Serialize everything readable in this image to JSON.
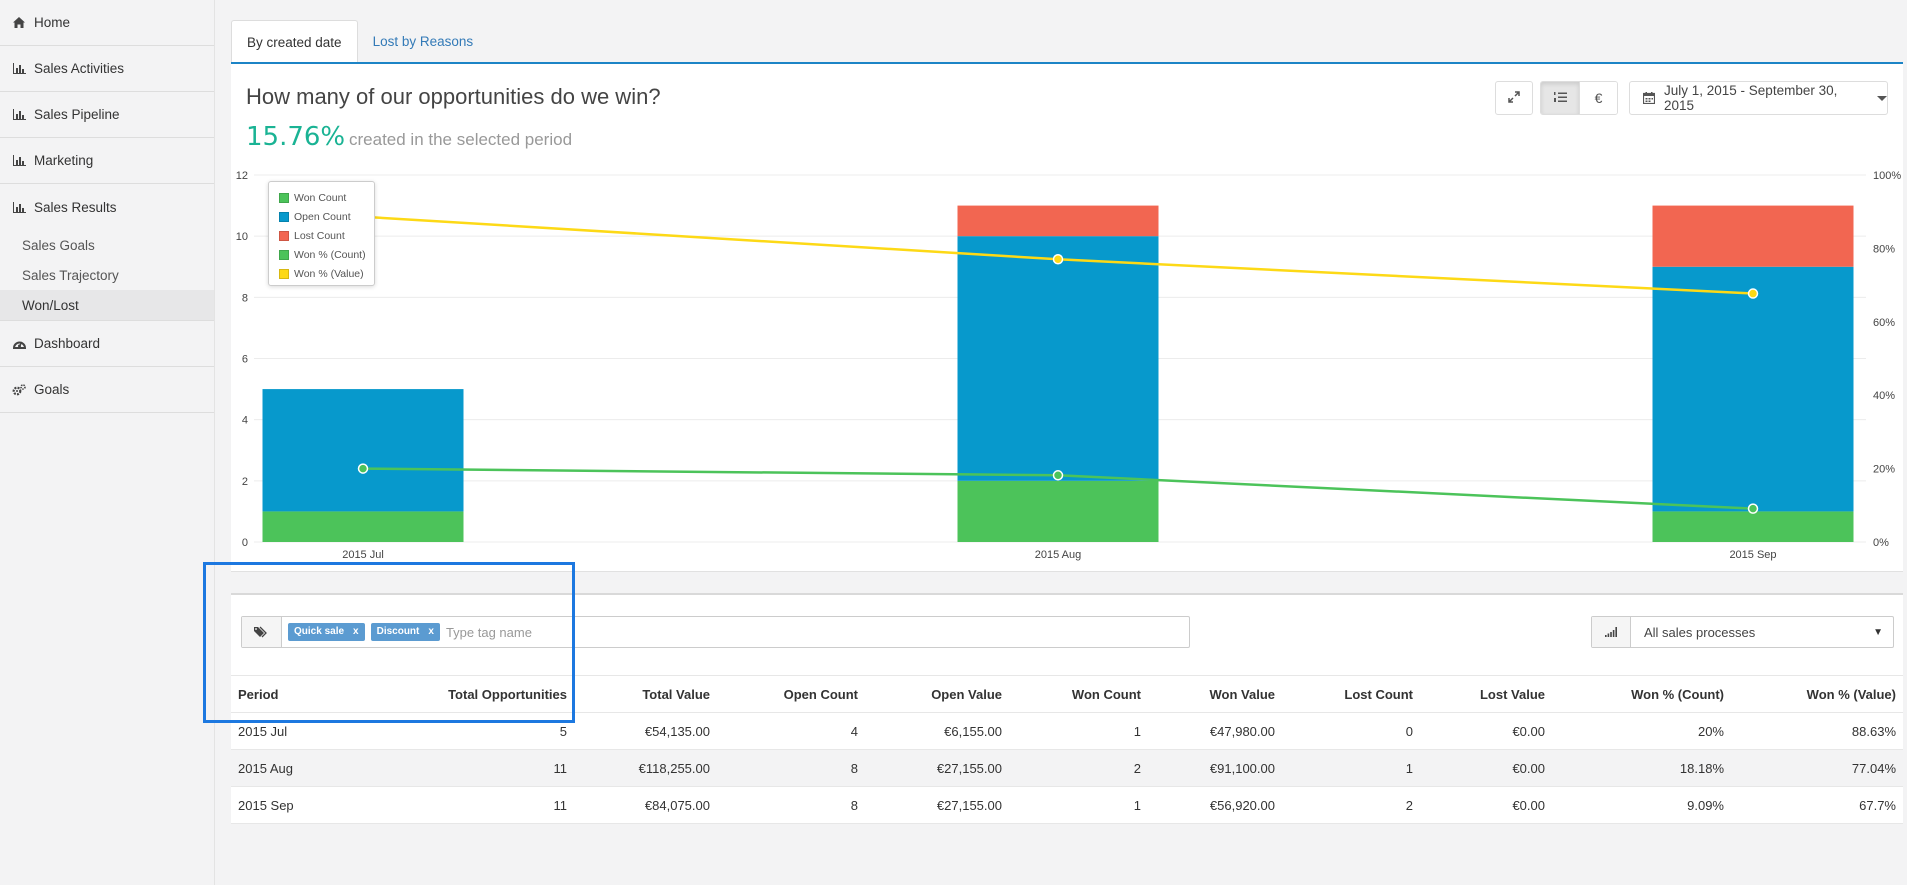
{
  "sidebar": {
    "items": [
      {
        "label": "Home",
        "icon": "home-icon"
      },
      {
        "label": "Sales Activities",
        "icon": "bar-chart-icon"
      },
      {
        "label": "Sales Pipeline",
        "icon": "bar-chart-icon"
      },
      {
        "label": "Marketing",
        "icon": "bar-chart-icon"
      },
      {
        "label": "Sales Results",
        "icon": "bar-chart-icon",
        "children": [
          "Sales Goals",
          "Sales Trajectory",
          "Won/Lost"
        ],
        "active_child": "Won/Lost"
      },
      {
        "label": "Dashboard",
        "icon": "dashboard-icon"
      },
      {
        "label": "Goals",
        "icon": "cogs-icon"
      }
    ]
  },
  "tabs": [
    {
      "label": "By created date",
      "active": true
    },
    {
      "label": "Lost by Reasons",
      "active": false
    }
  ],
  "panel": {
    "title": "How many of our opportunities do we win?",
    "win_rate": "15.76%",
    "win_rate_caption": "created in the selected period",
    "toolbar": {
      "expand_icon": "expand-icon",
      "list_icon": "list-ordered-icon",
      "currency_label": "€",
      "date_range": "July 1, 2015 - September 30, 2015"
    }
  },
  "chart_data": {
    "type": "bar",
    "stacked": true,
    "categories": [
      "2015 Jul",
      "2015 Aug",
      "2015 Sep"
    ],
    "series": [
      {
        "name": "Won Count",
        "type": "bar",
        "axis": "left",
        "color": "#4cc35a",
        "values": [
          1,
          2,
          1
        ]
      },
      {
        "name": "Open Count",
        "type": "bar",
        "axis": "left",
        "color": "#0799cc",
        "values": [
          4,
          8,
          8
        ]
      },
      {
        "name": "Lost Count",
        "type": "bar",
        "axis": "left",
        "color": "#f26651",
        "values": [
          0,
          1,
          2
        ]
      },
      {
        "name": "Won % (Count)",
        "type": "line",
        "axis": "right",
        "color": "#4cc35a",
        "values": [
          20,
          18.18,
          9.09
        ]
      },
      {
        "name": "Won % (Value)",
        "type": "line",
        "axis": "right",
        "color": "#fdd916",
        "values": [
          88.63,
          77.04,
          67.7
        ]
      }
    ],
    "y_left": {
      "min": 0,
      "max": 12,
      "ticks": [
        "0",
        "2",
        "4",
        "6",
        "8",
        "10",
        "12"
      ]
    },
    "y_right": {
      "min": 0,
      "max": 100,
      "ticks": [
        "0%",
        "20%",
        "40%",
        "60%",
        "80%",
        "100%"
      ]
    },
    "grid": true,
    "legend_position": "top-left"
  },
  "filters": {
    "tags_icon": "tags-icon",
    "tags": [
      "Quick sale",
      "Discount"
    ],
    "tag_remove": "x",
    "tag_placeholder": "Type tag name",
    "process_icon": "signal-icon",
    "process_value": "All sales processes",
    "process_caret": "▼"
  },
  "table": {
    "columns": [
      "Period",
      "Total Opportunities",
      "Total Value",
      "Open Count",
      "Open Value",
      "Won Count",
      "Won Value",
      "Lost Count",
      "Lost Value",
      "Won % (Count)",
      "Won % (Value)"
    ],
    "rows": [
      [
        "2015 Jul",
        "5",
        "€54,135.00",
        "4",
        "€6,155.00",
        "1",
        "€47,980.00",
        "0",
        "€0.00",
        "20%",
        "88.63%"
      ],
      [
        "2015 Aug",
        "11",
        "€118,255.00",
        "8",
        "€27,155.00",
        "2",
        "€91,100.00",
        "1",
        "€0.00",
        "18.18%",
        "77.04%"
      ],
      [
        "2015 Sep",
        "11",
        "€84,075.00",
        "8",
        "€27,155.00",
        "1",
        "€56,920.00",
        "2",
        "€0.00",
        "9.09%",
        "67.7%"
      ]
    ]
  }
}
